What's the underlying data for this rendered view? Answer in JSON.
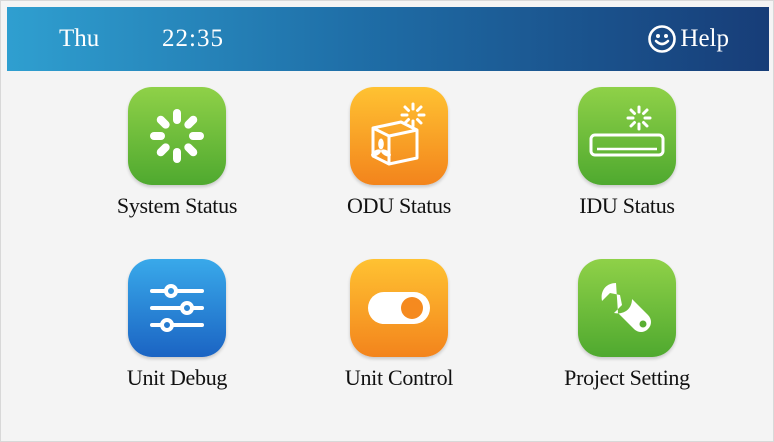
{
  "header": {
    "day": "Thu",
    "time": "22:35",
    "help_label": "Help",
    "help_icon": "smiley-face-icon"
  },
  "menu": [
    {
      "label": "System Status",
      "icon": "loading-spinner-icon",
      "color": "#5fb536"
    },
    {
      "label": "ODU Status",
      "icon": "outdoor-unit-fan-icon",
      "color": "#f7a022"
    },
    {
      "label": "IDU Status",
      "icon": "indoor-unit-ac-icon",
      "color": "#5fb536"
    },
    {
      "label": "Unit Debug",
      "icon": "sliders-icon",
      "color": "#2a84d6"
    },
    {
      "label": "Unit Control",
      "icon": "toggle-switch-icon",
      "color": "#f7a022"
    },
    {
      "label": "Project Setting",
      "icon": "wrench-icon",
      "color": "#5fb536"
    }
  ],
  "colors": {
    "header_gradient_start": "#2f9fd0",
    "header_gradient_end": "#173d78",
    "background": "#f4f4f4"
  }
}
